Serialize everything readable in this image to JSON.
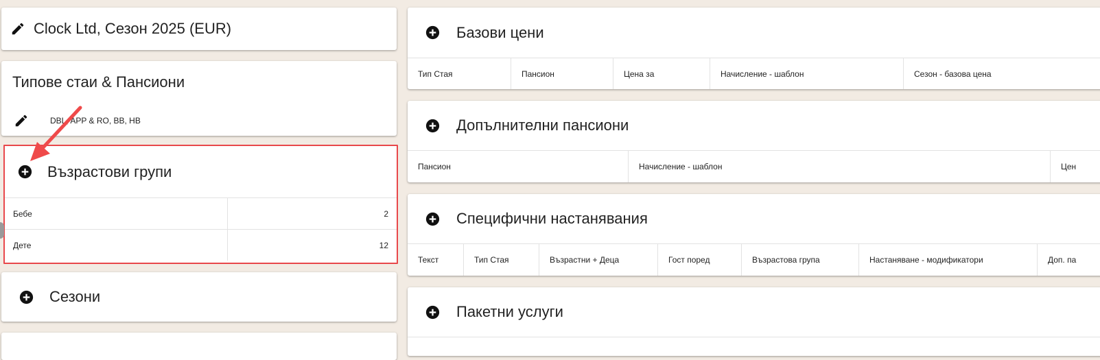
{
  "hotel_header": {
    "title": "Clock Ltd, Сезон 2025 (EUR)"
  },
  "room_types": {
    "title": "Типове стаи & Пансиони",
    "summary": "DBL, APP & RO, BB, HB"
  },
  "age_groups": {
    "title": "Възрастови групи",
    "rows": [
      {
        "name": "Бебе",
        "value": "2"
      },
      {
        "name": "Дете",
        "value": "12"
      }
    ]
  },
  "seasons": {
    "title": "Сезони"
  },
  "base_prices": {
    "title": "Базови цени",
    "columns": [
      "Тип Стая",
      "Пансион",
      "Цена за",
      "Начисление - шаблон",
      "Сезон - базова цена"
    ]
  },
  "extra_boards": {
    "title": "Допълнителни пансиони",
    "columns": [
      "Пансион",
      "Начисление - шаблон",
      "Цен"
    ]
  },
  "specific_accommodations": {
    "title": "Специфични настанявания",
    "columns": [
      "Текст",
      "Тип Стая",
      "Възрастни + Деца",
      "Гост поред",
      "Възрастова група",
      "Настаняване - модификатори",
      "Доп. па"
    ]
  },
  "package_services": {
    "title": "Пакетни услуги"
  },
  "colors": {
    "highlight_border": "#e8474a",
    "arrow": "#ef4a4a",
    "background": "#f2ebe3"
  },
  "icons": {
    "edit": "pencil-icon",
    "add": "plus-circle-icon"
  }
}
